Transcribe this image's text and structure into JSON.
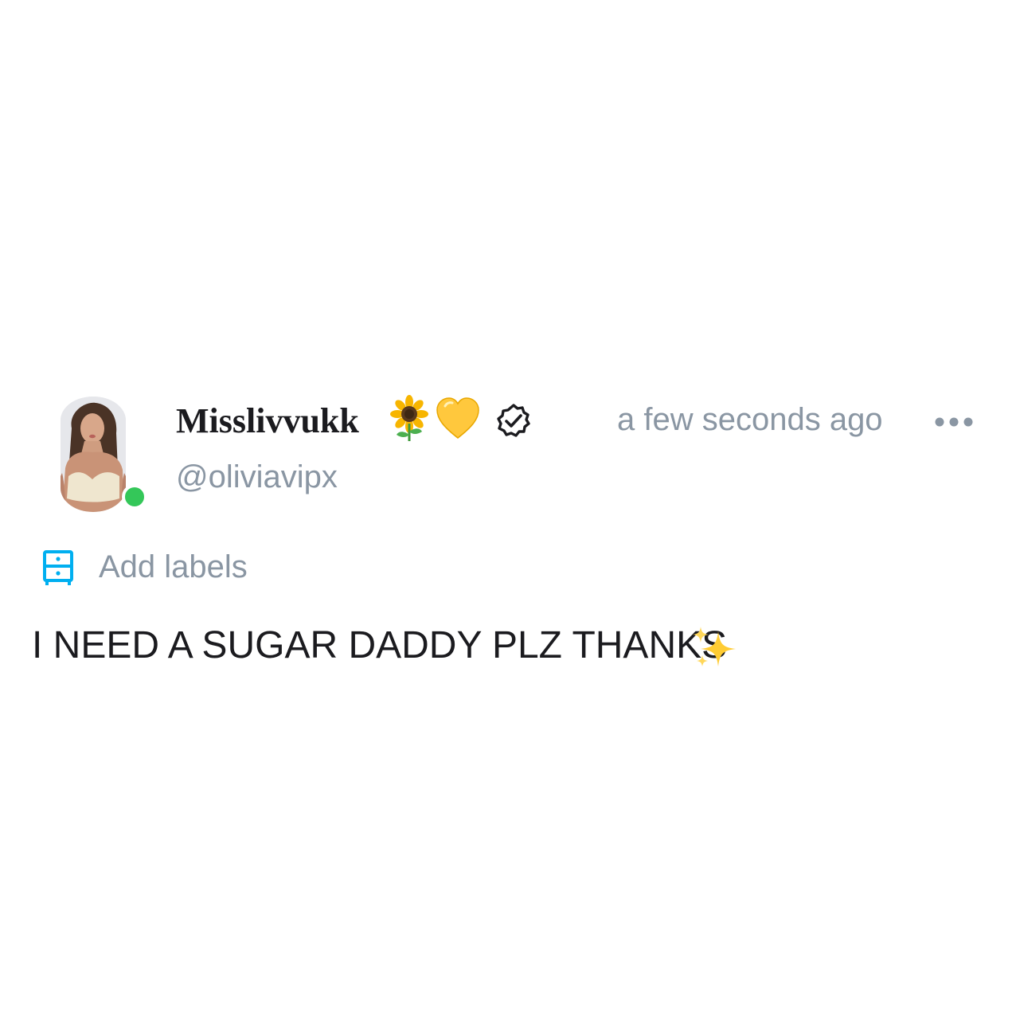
{
  "post": {
    "author": {
      "display_name": "Misslivvukk",
      "name_emojis": [
        "sunflower-emoji",
        "yellow-heart-emoji"
      ],
      "verified": true,
      "handle": "@oliviavipx",
      "online": true,
      "online_color": "#34c759"
    },
    "timestamp": "a few seconds ago",
    "more_icon": "more-dots-icon",
    "add_labels": {
      "icon": "labels-icon",
      "label": "Add labels",
      "accent_color": "#00aff0"
    },
    "text": "I NEED A SUGAR DADDY PLZ THANKS",
    "text_emoji": "sparkles-emoji"
  },
  "colors": {
    "primary_text": "#1b1b1f",
    "secondary_text": "#8a96a3",
    "background": "#ffffff"
  }
}
